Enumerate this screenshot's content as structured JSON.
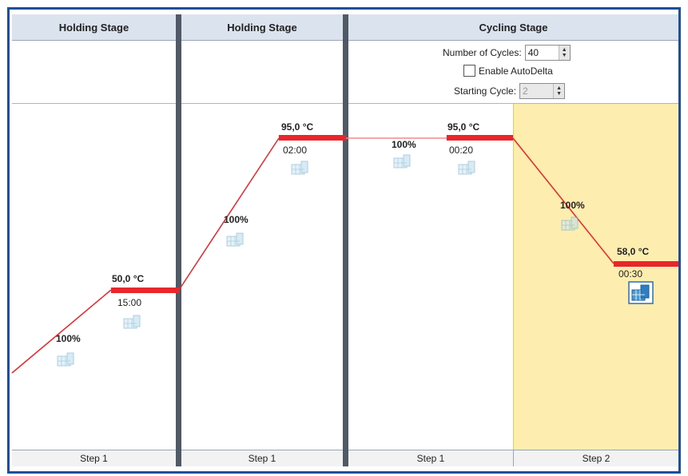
{
  "stages": [
    {
      "header": "Holding Stage",
      "steps": [
        {
          "footer": "Step 1"
        }
      ]
    },
    {
      "header": "Holding Stage",
      "steps": [
        {
          "footer": "Step 1"
        }
      ]
    },
    {
      "header": "Cycling Stage",
      "steps": [
        {
          "footer": "Step 1"
        },
        {
          "footer": "Step 2"
        }
      ],
      "settings": {
        "cycles_label": "Number of Cycles:",
        "cycles_value": "40",
        "autodelta_label": "Enable AutoDelta",
        "autodelta_checked": false,
        "starting_cycle_label": "Starting Cycle:",
        "starting_cycle_value": "2"
      }
    }
  ],
  "profile": [
    {
      "stage": 0,
      "step": 1,
      "temperature": "50,0 °C",
      "time": "15:00",
      "ramp_rate": "100%"
    },
    {
      "stage": 1,
      "step": 1,
      "temperature": "95,0 °C",
      "time": "02:00",
      "ramp_rate": "100%"
    },
    {
      "stage": 2,
      "step": 1,
      "temperature": "95,0 °C",
      "time": "00:20",
      "ramp_rate": "100%"
    },
    {
      "stage": 2,
      "step": 2,
      "temperature": "58,0 °C",
      "time": "00:30",
      "ramp_rate": "100%",
      "selected": true
    }
  ],
  "colors": {
    "border": "#1d4f9a",
    "hold_line": "#e8262b",
    "ramp_line": "#e8262b",
    "selected_step_bg": "#fdeeb0",
    "header_bg": "#dbe3ee",
    "divider": "#4f5a66"
  },
  "icons": {
    "data_collection_icon": "camera-collection-icon",
    "data_collection_selected_icon": "camera-collection-selected-icon"
  }
}
